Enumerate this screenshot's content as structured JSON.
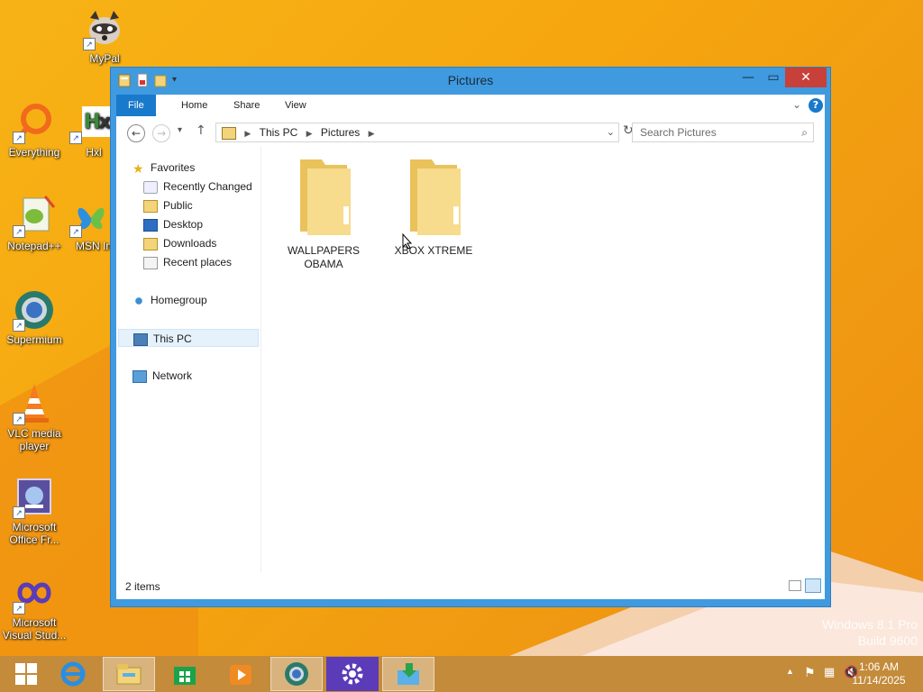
{
  "desktop": {
    "icons": [
      {
        "label": "MyPal"
      },
      {
        "label": "Everything"
      },
      {
        "label": "Hxl"
      },
      {
        "label": "Notepad++"
      },
      {
        "label": "MSN In"
      },
      {
        "label": "Supermium"
      },
      {
        "label": "VLC media player"
      },
      {
        "label": "Microsoft Office Fr..."
      },
      {
        "label": "Microsoft Visual Stud..."
      }
    ],
    "watermark": {
      "line1": "Windows 8.1 Pro",
      "line2": "Build 9600"
    }
  },
  "window": {
    "title": "Pictures",
    "ribbon_tabs": [
      "File",
      "Home",
      "Share",
      "View"
    ],
    "address": {
      "segments": [
        "This PC",
        "Pictures"
      ]
    },
    "search": {
      "placeholder": "Search Pictures"
    },
    "nav": {
      "favorites_label": "Favorites",
      "favorites": [
        "Recently Changed",
        "Public",
        "Desktop",
        "Downloads",
        "Recent places"
      ],
      "homegroup": "Homegroup",
      "this_pc": "This PC",
      "network": "Network"
    },
    "folders": [
      {
        "name": "WALLPAPERS OBAMA"
      },
      {
        "name": "XBOX XTREME"
      }
    ],
    "status": "2 items"
  },
  "taskbar": {
    "clock": {
      "time": "1:06 AM",
      "date": "11/14/2025"
    }
  },
  "colors": {
    "accent": "#3f9ae0",
    "file_tab": "#1979ca",
    "close": "#c7403a",
    "desktop": "#f7b316"
  }
}
